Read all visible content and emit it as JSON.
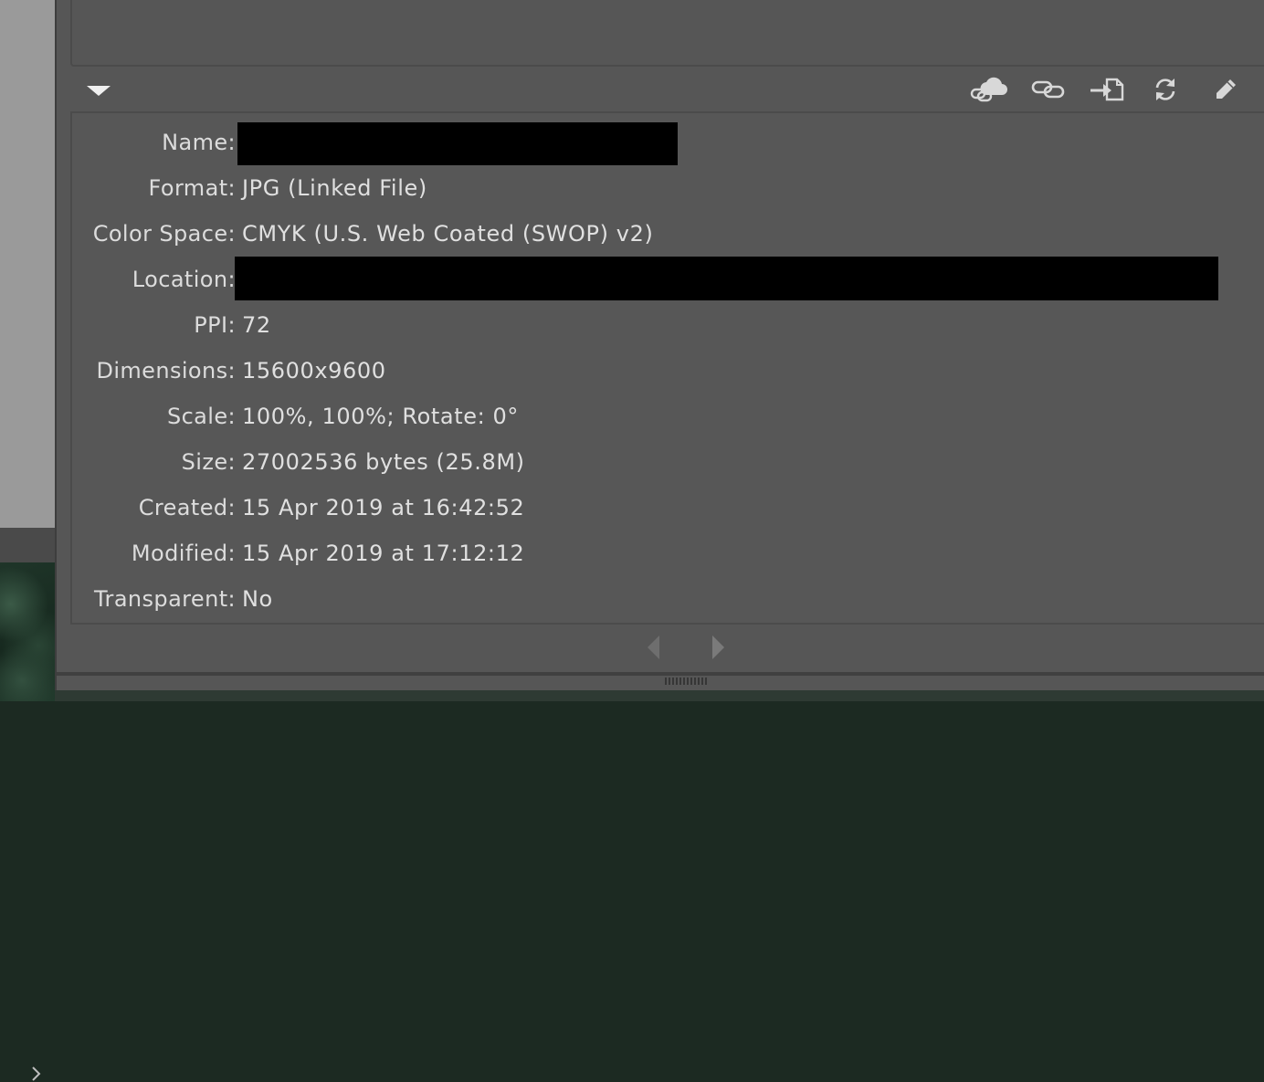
{
  "toolbar": {
    "icons": [
      "cloud-link-icon",
      "relink-icon",
      "place-icon",
      "update-link-icon",
      "edit-original-icon"
    ]
  },
  "info": {
    "rows": [
      {
        "label": "Name:",
        "value": ""
      },
      {
        "label": "Format:",
        "value": "JPG (Linked File)"
      },
      {
        "label": "Color Space:",
        "value": "CMYK (U.S. Web Coated (SWOP) v2)"
      },
      {
        "label": "Location:",
        "value": ""
      },
      {
        "label": "PPI:",
        "value": "72"
      },
      {
        "label": "Dimensions:",
        "value": "15600x9600"
      },
      {
        "label": "Scale:",
        "value": "100%, 100%; Rotate: 0°"
      },
      {
        "label": "Size:",
        "value": "27002536 bytes (25.8M)"
      },
      {
        "label": "Created:",
        "value": "15 Apr 2019 at 16:42:52"
      },
      {
        "label": "Modified:",
        "value": "15 Apr 2019 at 17:12:12"
      },
      {
        "label": "Transparent:",
        "value": "No"
      }
    ]
  },
  "colors": {
    "panel_bg": "#565656",
    "text": "#dcdcdc",
    "icon": "#d8d8d8",
    "redaction": "#000000"
  }
}
